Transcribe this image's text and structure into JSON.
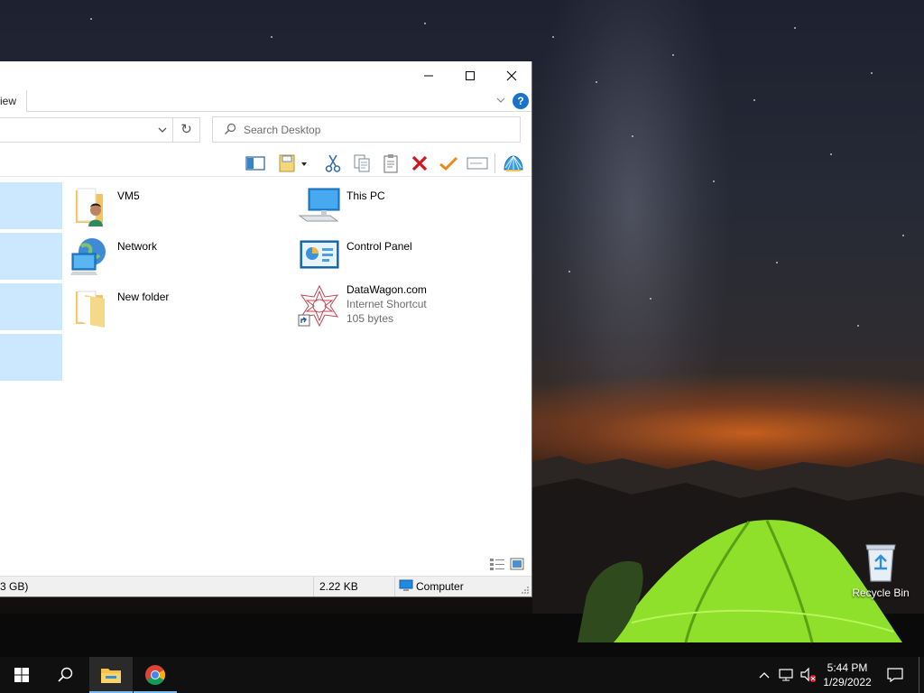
{
  "window": {
    "ribbon_tab": "iew",
    "search_placeholder": "Search Desktop",
    "buttons": {
      "minimize": "minimize-icon",
      "maximize": "maximize-icon",
      "close": "close-icon",
      "help": "?"
    }
  },
  "toolbar": {
    "icons": [
      "preview-pane-icon",
      "properties-icon",
      "cut-icon",
      "copy-icon",
      "paste-icon",
      "delete-icon",
      "check-icon",
      "rename-icon",
      "shell-icon"
    ]
  },
  "items": [
    {
      "name": "VM5",
      "icon": "user-folder-icon"
    },
    {
      "name": "This PC",
      "icon": "computer-icon"
    },
    {
      "name": "Network",
      "icon": "network-icon"
    },
    {
      "name": "Control Panel",
      "icon": "control-panel-icon"
    },
    {
      "name": "New folder",
      "icon": "folder-icon"
    },
    {
      "name": "DataWagon.com",
      "sub1": "Internet Shortcut",
      "sub2": "105 bytes",
      "icon": "internet-shortcut-icon"
    }
  ],
  "status": {
    "free_space": "3 GB)",
    "size": "2.22 KB",
    "location": "Computer"
  },
  "desktop": {
    "recycle_bin": "Recycle Bin"
  },
  "taskbar": {
    "time": "5:44 PM",
    "date": "1/29/2022",
    "accent": "#76b9ed"
  }
}
